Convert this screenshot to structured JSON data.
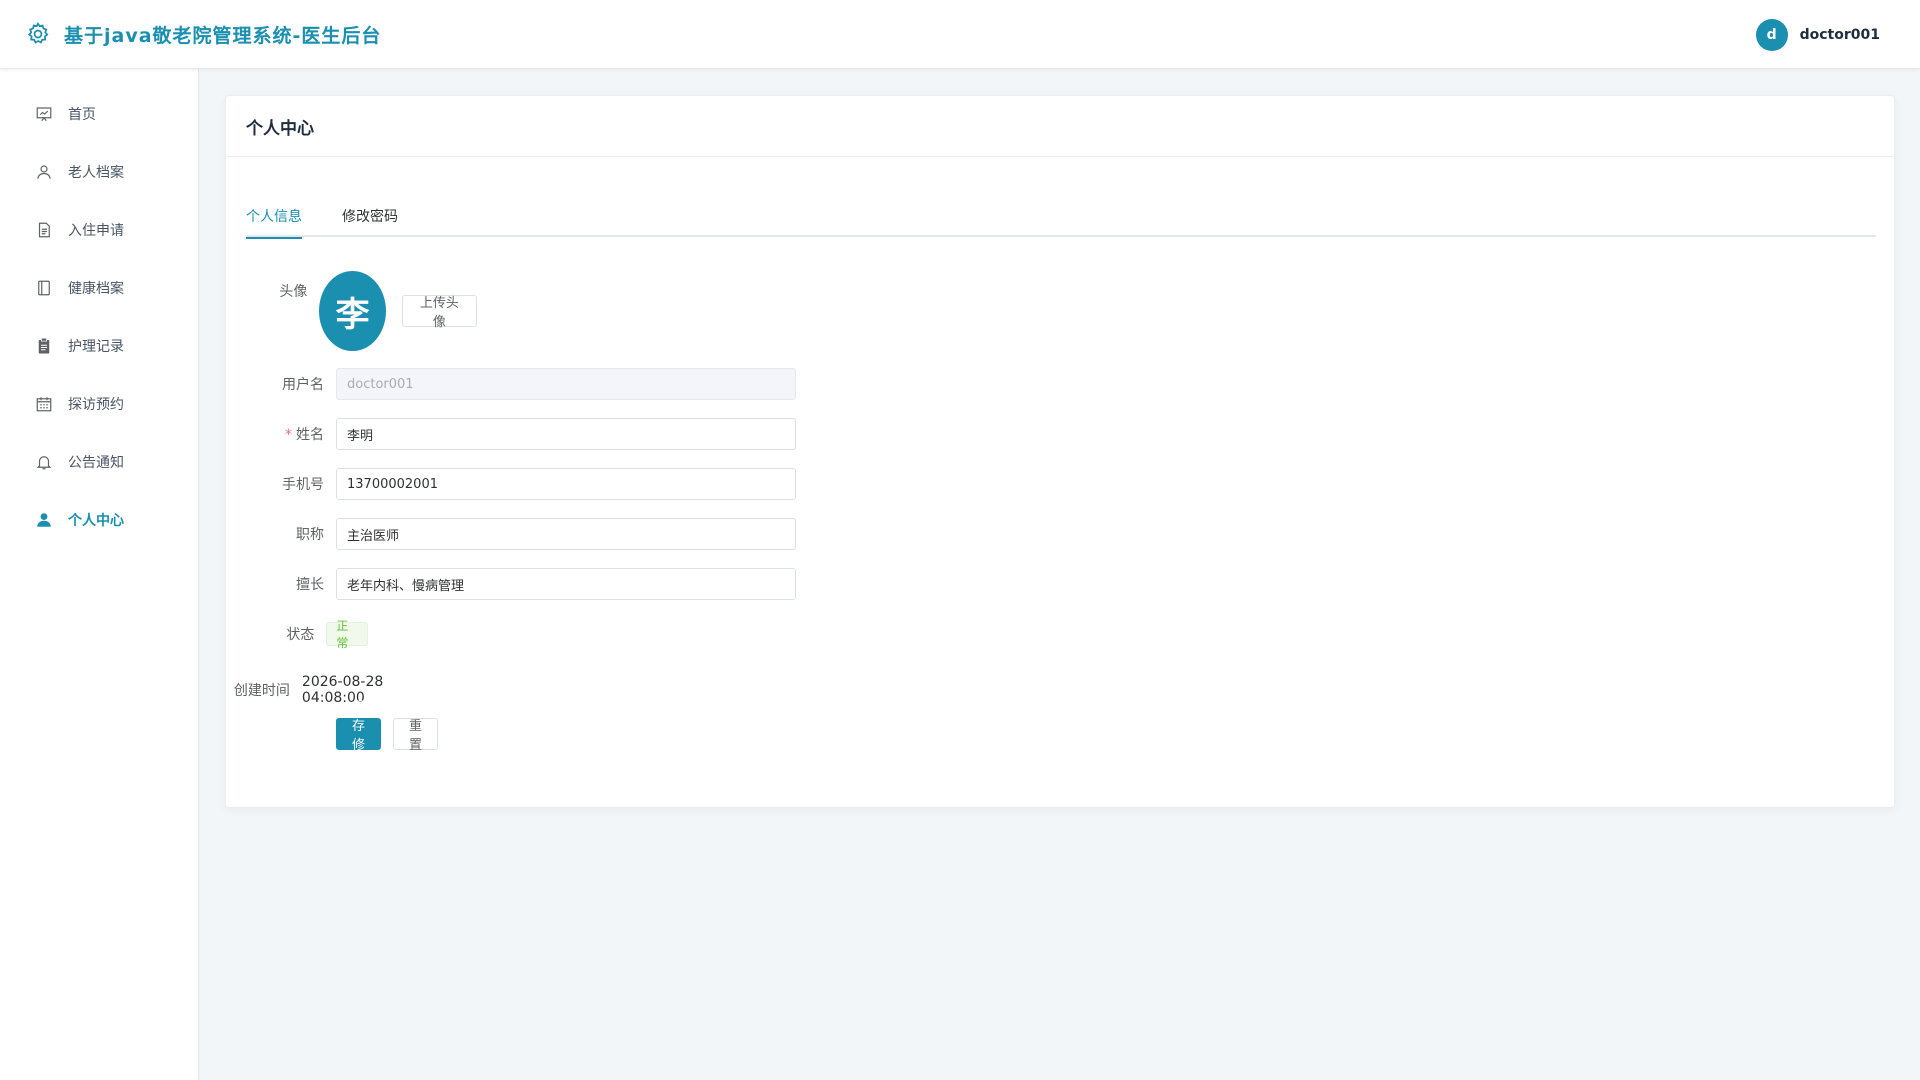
{
  "header": {
    "title": "基于java敬老院管理系统-医生后台",
    "brand_icon": "gear-icon",
    "user": {
      "avatar_letter": "d",
      "name": "doctor001"
    }
  },
  "sidebar": {
    "items": [
      {
        "label": "首页",
        "icon": "dashboard-icon",
        "active": false
      },
      {
        "label": "老人档案",
        "icon": "user-icon",
        "active": false
      },
      {
        "label": "入住申请",
        "icon": "document-icon",
        "active": false
      },
      {
        "label": "健康档案",
        "icon": "notebook-icon",
        "active": false
      },
      {
        "label": "护理记录",
        "icon": "clipboard-icon",
        "active": false
      },
      {
        "label": "探访预约",
        "icon": "calendar-icon",
        "active": false
      },
      {
        "label": "公告通知",
        "icon": "bell-icon",
        "active": false
      },
      {
        "label": "个人中心",
        "icon": "user-filled-icon",
        "active": true
      }
    ]
  },
  "page": {
    "title": "个人中心",
    "tabs": [
      {
        "label": "个人信息",
        "active": true
      },
      {
        "label": "修改密码",
        "active": false
      }
    ]
  },
  "form": {
    "avatar": {
      "label": "头像",
      "letter": "李",
      "upload_label": "上传头像"
    },
    "username": {
      "label": "用户名",
      "value": "doctor001"
    },
    "name": {
      "label": "姓名",
      "required_mark": "*",
      "value": "李明"
    },
    "phone": {
      "label": "手机号",
      "value": "13700002001"
    },
    "title": {
      "label": "职称",
      "value": "主治医师"
    },
    "specialty": {
      "label": "擅长",
      "value": "老年内科、慢病管理"
    },
    "status": {
      "label": "状态",
      "value": "正常"
    },
    "created": {
      "label": "创建时间",
      "value": "2026-08-28 04:08:00"
    },
    "save_label": "保存修改",
    "reset_label": "重置"
  },
  "colors": {
    "accent": "#1a8fb0",
    "status_success": "#67c23a",
    "required": "#f56c6c"
  }
}
